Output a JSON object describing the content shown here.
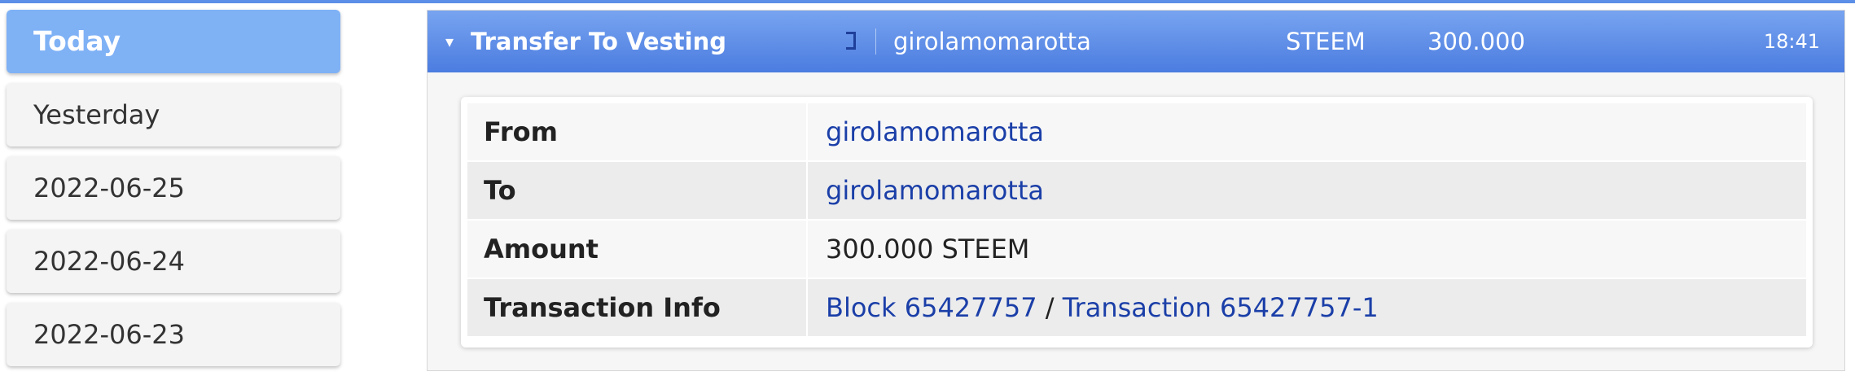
{
  "sidebar": {
    "dates": [
      {
        "label": "Today",
        "active": true
      },
      {
        "label": "Yesterday",
        "active": false
      },
      {
        "label": "2022-06-25",
        "active": false
      },
      {
        "label": "2022-06-24",
        "active": false
      },
      {
        "label": "2022-06-23",
        "active": false
      }
    ]
  },
  "operation": {
    "caret": "▾",
    "title": "Transfer To Vesting",
    "icon": "external-link-icon",
    "account": "girolamomarotta",
    "asset": "STEEM",
    "amount": "300.000",
    "time": "18:41"
  },
  "details": {
    "from_label": "From",
    "from_value": "girolamomarotta",
    "to_label": "To",
    "to_value": "girolamomarotta",
    "amount_label": "Amount",
    "amount_value": "300.000 STEEM",
    "tx_label": "Transaction Info",
    "block_link": "Block 65427757",
    "tx_sep": " / ",
    "tx_link": "Transaction 65427757-1"
  },
  "colors": {
    "accent": "#5b8fe8",
    "active_date": "#7fb1f5",
    "link": "#1b3fa8"
  }
}
